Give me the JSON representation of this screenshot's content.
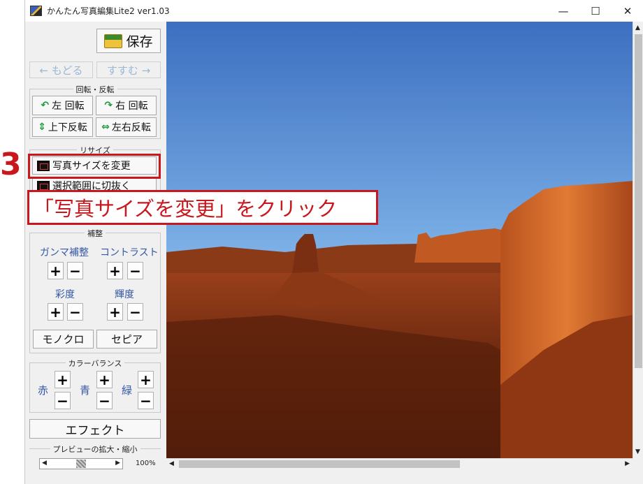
{
  "window": {
    "title": "かんたん写真編集Lite2 ver1.03",
    "controls": {
      "minimize": "—",
      "maximize": "☐",
      "close": "✕"
    }
  },
  "toolbar": {
    "save_label": "保存",
    "back_label": "← もどる",
    "forward_label": "すすむ →"
  },
  "rotate_group": {
    "legend": "回転・反転",
    "rotate_left": "左 回転",
    "rotate_right": "右 回転",
    "flip_vertical": "上下反転",
    "flip_horizontal": "左右反転"
  },
  "resize_group": {
    "legend": "リサイズ",
    "change_size": "写真サイズを変更",
    "crop": "選択範囲に切抜く"
  },
  "adjust_group": {
    "legend": "補整",
    "gamma": "ガンマ補整",
    "contrast": "コントラスト",
    "saturation": "彩度",
    "brightness": "輝度",
    "plus": "+",
    "minus": "−",
    "mono": "モノクロ",
    "sepia": "セピア"
  },
  "color_balance": {
    "legend": "カラーバランス",
    "red": "赤",
    "blue": "青",
    "green": "緑"
  },
  "effect_label": "エフェクト",
  "preview": {
    "legend": "プレビューの拡大・縮小",
    "zoom": "100%",
    "zoom_fraction": 0.5
  },
  "annotation": {
    "step": "3",
    "callout": "「写真サイズを変更」をクリック",
    "color": "#c8181e"
  }
}
